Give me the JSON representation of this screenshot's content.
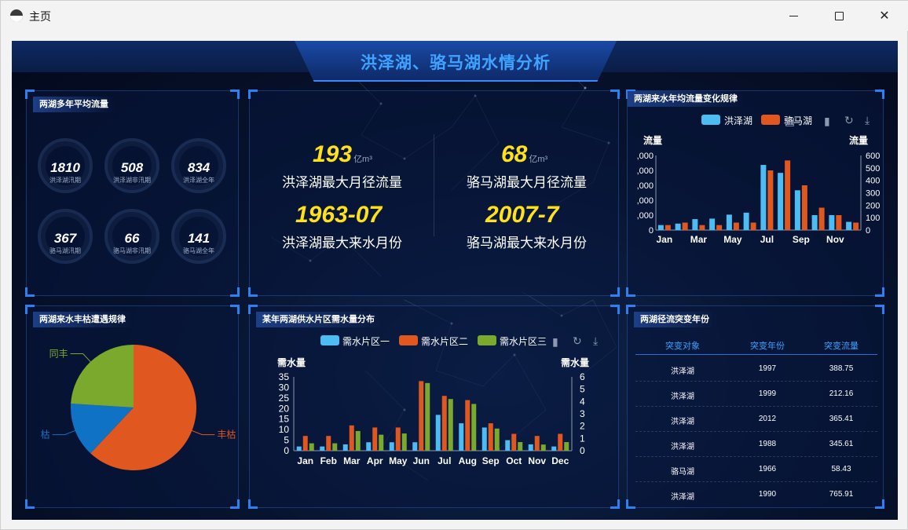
{
  "window": {
    "title": "主页"
  },
  "header": {
    "title": "洪泽湖、骆马湖水情分析"
  },
  "panel_avg_flow": {
    "title": "两湖多年平均流量",
    "rings": [
      {
        "value": "1810",
        "label": "洪泽湖汛期"
      },
      {
        "value": "508",
        "label": "洪泽湖非汛期"
      },
      {
        "value": "834",
        "label": "洪泽湖全年"
      },
      {
        "value": "367",
        "label": "骆马湖汛期"
      },
      {
        "value": "66",
        "label": "骆马湖非汛期"
      },
      {
        "value": "141",
        "label": "骆马湖全年"
      }
    ]
  },
  "panel_stats": {
    "items": [
      {
        "value": "193",
        "unit": "亿m³",
        "label": "洪泽湖最大月径流量"
      },
      {
        "value": "68",
        "unit": "亿m³",
        "label": "骆马湖最大月径流量"
      },
      {
        "value": "1963-07",
        "unit": "",
        "label": "洪泽湖最大来水月份"
      },
      {
        "value": "2007-7",
        "unit": "",
        "label": "骆马湖最大来水月份"
      }
    ]
  },
  "panel_monthly": {
    "title": "两湖来水年均流量变化规律",
    "legend": [
      "洪泽湖",
      "骆马湖"
    ],
    "left_axis_name": "流量",
    "right_axis_name": "流量",
    "colors": {
      "hz": "#4cbcf2",
      "lm": "#e0571f"
    }
  },
  "panel_pie": {
    "title": "两湖来水丰枯遭遇规律",
    "colors": {
      "丰枯": "#e0571f",
      "枯": "#0f72c4",
      "同丰": "#7aa92e"
    }
  },
  "panel_demand": {
    "title": "某年两湖供水片区需水量分布",
    "legend": [
      "需水片区一",
      "需水片区二",
      "需水片区三"
    ],
    "left_axis_name": "需水量",
    "right_axis_name": "需水量",
    "colors": {
      "z1": "#4cbcf2",
      "z2": "#e0571f",
      "z3": "#7aa92e"
    }
  },
  "panel_table": {
    "title": "两湖径流突变年份",
    "headers": [
      "突变对象",
      "突变年份",
      "突变流量"
    ],
    "rows": [
      [
        "洪泽湖",
        "1997",
        "388.75"
      ],
      [
        "洪泽湖",
        "1999",
        "212.16"
      ],
      [
        "洪泽湖",
        "2012",
        "365.41"
      ],
      [
        "洪泽湖",
        "1988",
        "345.61"
      ],
      [
        "骆马湖",
        "1966",
        "58.43"
      ],
      [
        "洪泽湖",
        "1990",
        "765.91"
      ]
    ]
  },
  "chart_data": [
    {
      "type": "bar",
      "title": "两湖来水年均流量变化规律",
      "categories": [
        "Jan",
        "Feb",
        "Mar",
        "Apr",
        "May",
        "Jun",
        "Jul",
        "Aug",
        "Sep",
        "Oct",
        "Nov",
        "Dec"
      ],
      "x_tick_labels": [
        "Jan",
        "Mar",
        "May",
        "Jul",
        "Sep",
        "Nov"
      ],
      "series": [
        {
          "name": "洪泽湖",
          "axis": "left",
          "values": [
            200,
            260,
            440,
            460,
            620,
            700,
            2620,
            2300,
            1600,
            600,
            600,
            330
          ]
        },
        {
          "name": "骆马湖",
          "axis": "right",
          "values": [
            40,
            60,
            40,
            40,
            60,
            60,
            480,
            560,
            360,
            180,
            120,
            60
          ]
        }
      ],
      "y_left": {
        "name": "流量",
        "ylim": [
          0,
          3000
        ],
        "tick_labels": [
          ",000",
          ",000",
          ",000",
          ",000",
          ",000",
          "0"
        ]
      },
      "y_right": {
        "name": "流量",
        "ylim": [
          0,
          600
        ],
        "ticks": [
          0,
          100,
          200,
          300,
          400,
          500,
          600
        ]
      },
      "legend_position": "top-right"
    },
    {
      "type": "pie",
      "title": "两湖来水丰枯遭遇规律",
      "labels": [
        "丰枯",
        "枯",
        "同丰"
      ],
      "values": [
        62,
        14,
        24
      ],
      "legend_position": "none"
    },
    {
      "type": "bar",
      "title": "某年两湖供水片区需水量分布",
      "categories": [
        "Jan",
        "Feb",
        "Mar",
        "Apr",
        "May",
        "Jun",
        "Jul",
        "Aug",
        "Sep",
        "Oct",
        "Nov",
        "Dec"
      ],
      "series": [
        {
          "name": "需水片区一",
          "axis": "left",
          "values": [
            2,
            2,
            3,
            4,
            4,
            4,
            17,
            13,
            11,
            5,
            3,
            2
          ]
        },
        {
          "name": "需水片区二",
          "axis": "left",
          "values": [
            7,
            7,
            12,
            11,
            11,
            33,
            26,
            24,
            13,
            8,
            7,
            8
          ]
        },
        {
          "name": "需水片区三",
          "axis": "right",
          "values": [
            0.6,
            0.6,
            1.6,
            1.3,
            1.4,
            5.5,
            4.2,
            3.8,
            1.8,
            0.7,
            0.5,
            0.7
          ]
        }
      ],
      "y_left": {
        "name": "需水量",
        "ylim": [
          0,
          35
        ],
        "ticks": [
          0,
          5,
          10,
          15,
          20,
          25,
          30,
          35
        ]
      },
      "y_right": {
        "name": "需水量",
        "ylim": [
          0,
          6
        ],
        "ticks": [
          0,
          1,
          2,
          3,
          4,
          5,
          6
        ]
      },
      "legend_position": "top"
    }
  ]
}
